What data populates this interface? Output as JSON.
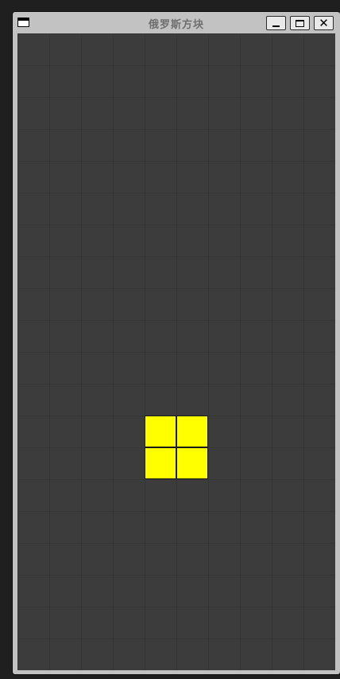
{
  "window": {
    "title": "俄罗斯方块",
    "buttons": [
      "minimize",
      "maximize",
      "close"
    ]
  },
  "board": {
    "columns": 10,
    "rows": 20,
    "background_color": "#3c3c3c",
    "grid_line_color": "#353535",
    "active_piece": {
      "shape": "O",
      "color": "#ffff00",
      "cells": [
        {
          "col": 4,
          "row": 12
        },
        {
          "col": 5,
          "row": 12
        },
        {
          "col": 4,
          "row": 13
        },
        {
          "col": 5,
          "row": 13
        }
      ]
    }
  }
}
